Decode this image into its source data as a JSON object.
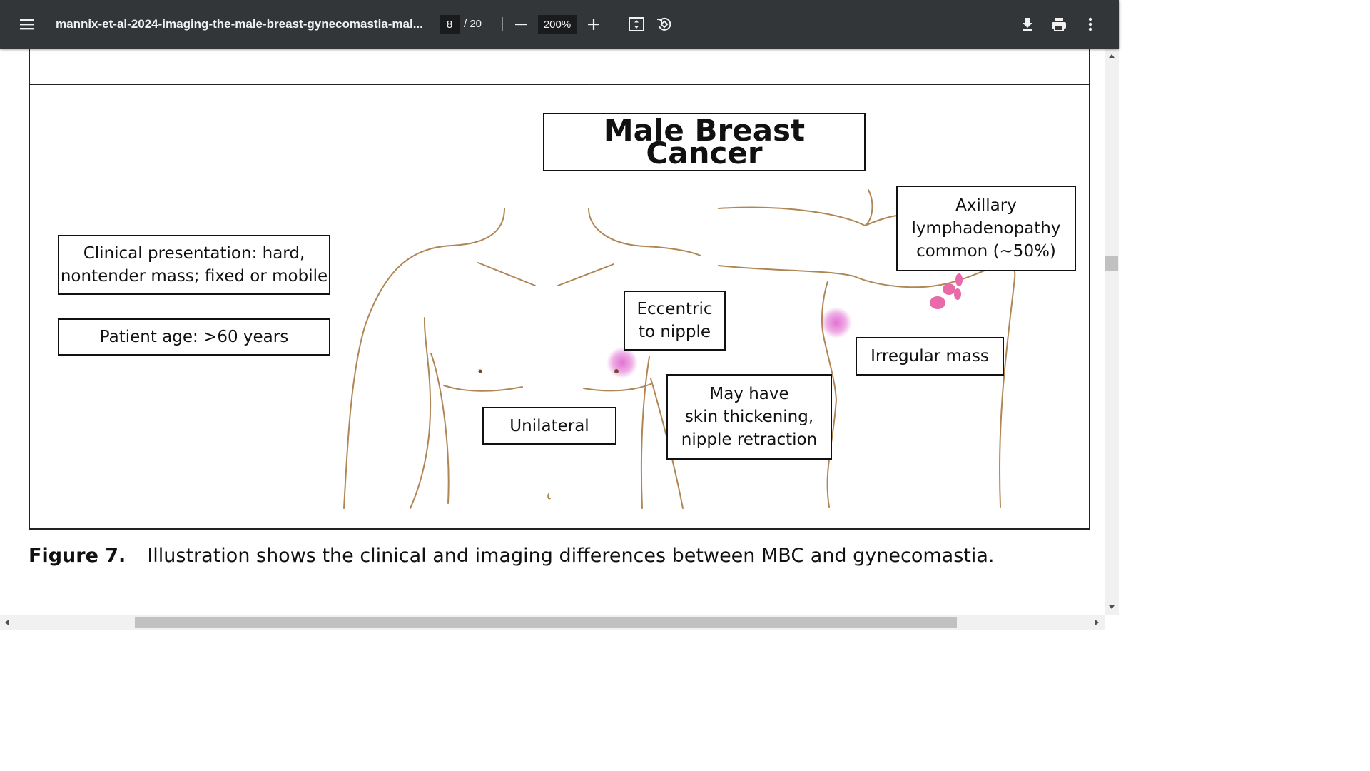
{
  "toolbar": {
    "menu_icon": "menu-icon",
    "title": "mannix-et-al-2024-imaging-the-male-breast-gynecomastia-mal...",
    "page_current": "8",
    "page_total": "/ 20",
    "zoom_value": "200%",
    "icons": [
      "zoom-out-icon",
      "zoom-in-icon",
      "fit-page-icon",
      "rotate-icon",
      "download-icon",
      "print-icon",
      "more-options-icon"
    ]
  },
  "figure": {
    "title": "Male Breast Cancer",
    "labels": {
      "clinical": "Clinical presentation: hard,\nnontender mass; fixed or mobile",
      "age": "Patient age: >60 years",
      "axillary": "Axillary\nlymphadenopathy\ncommon (~50%)",
      "eccentric": "Eccentric\nto nipple",
      "irregular": "Irregular mass",
      "skin": "May have\nskin thickening,\nnipple retraction",
      "unilateral": "Unilateral"
    },
    "colors": {
      "outline": "#b08655",
      "mass": "#e06ad0",
      "nodes": "#e86aa8"
    }
  },
  "caption": {
    "label": "Figure 7.",
    "text": "Illustration shows the clinical and imaging differences between MBC and gynecomastia."
  }
}
